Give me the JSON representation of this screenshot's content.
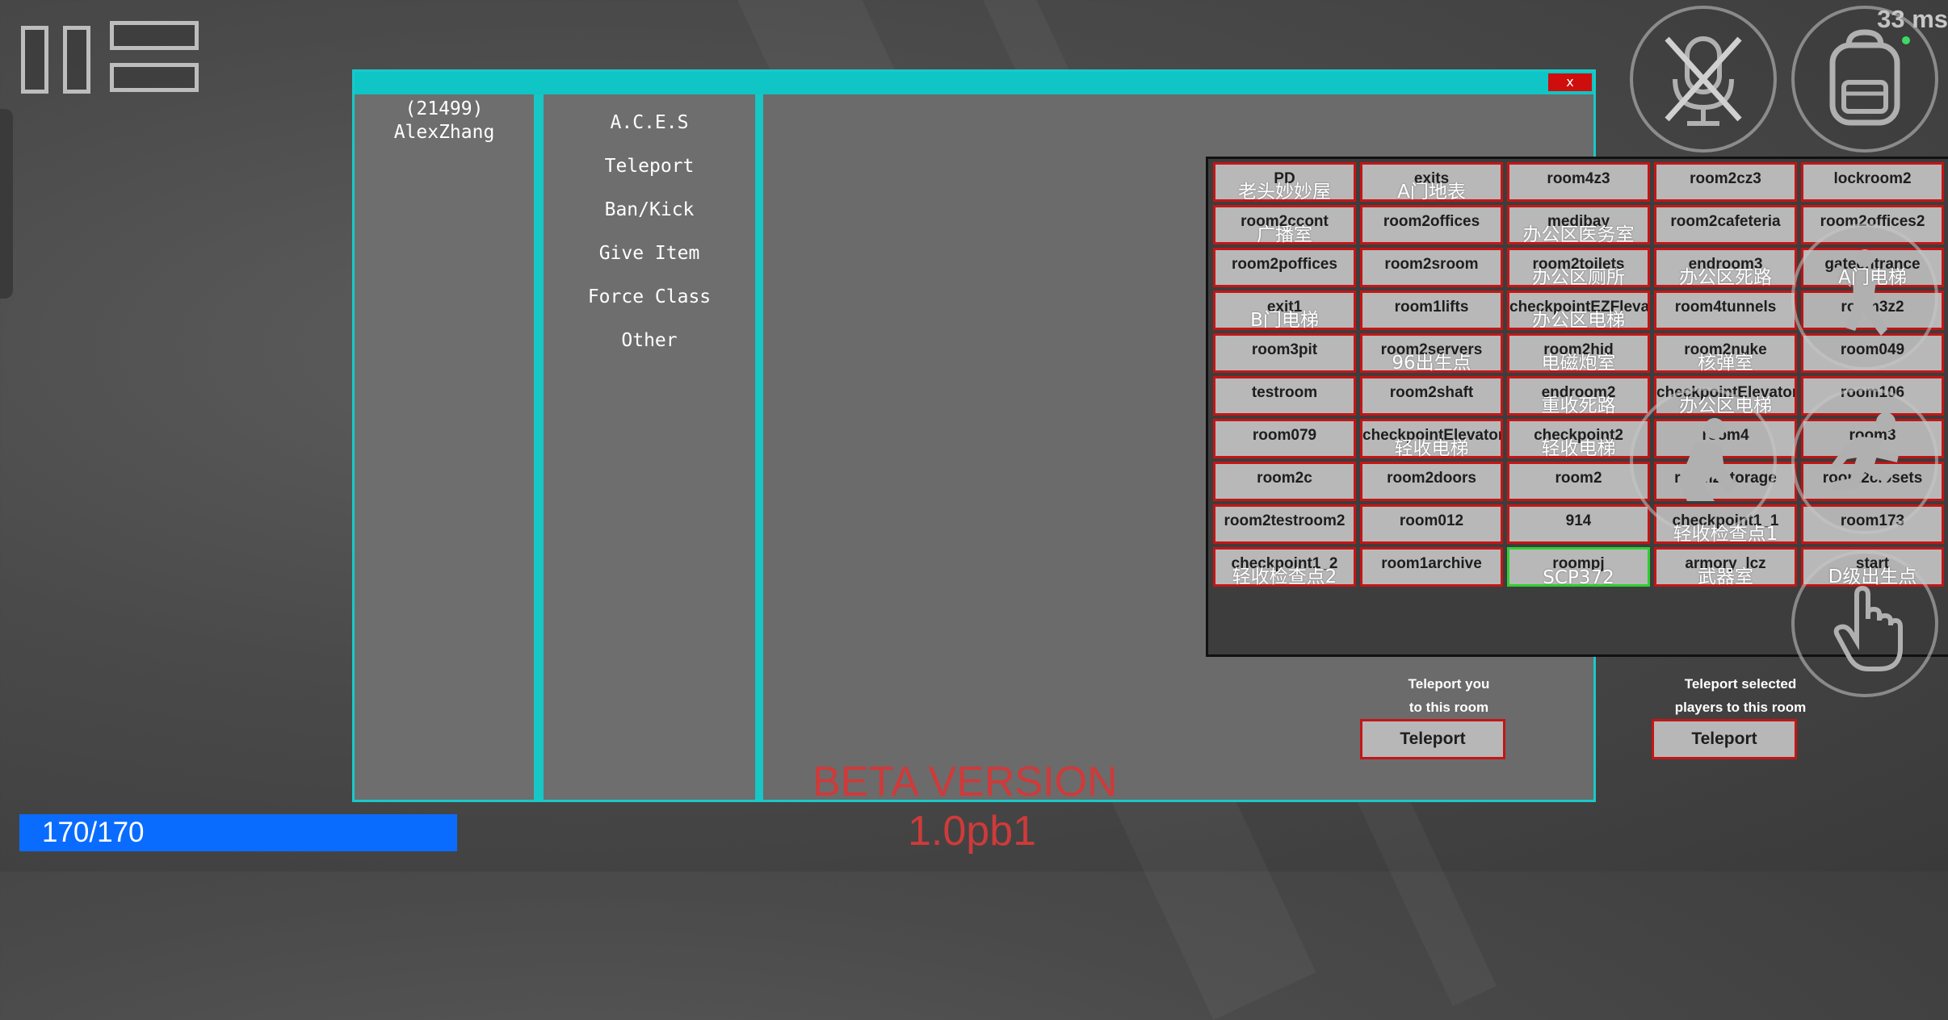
{
  "player": {
    "id": "(21499)",
    "name": "AlexZhang"
  },
  "menu": [
    "A.C.E.S",
    "Teleport",
    "Ban/Kick",
    "Give Item",
    "Force Class",
    "Other"
  ],
  "close_label": "x",
  "rooms": [
    {
      "name": "PD",
      "cn": "老头妙妙屋"
    },
    {
      "name": "exits",
      "cn": "A门地表"
    },
    {
      "name": "room4z3",
      "cn": ""
    },
    {
      "name": "room2cz3",
      "cn": ""
    },
    {
      "name": "lockroom2",
      "cn": ""
    },
    {
      "name": "room2ccont",
      "cn": "广播室"
    },
    {
      "name": "room2offices",
      "cn": ""
    },
    {
      "name": "medibay",
      "cn": "办公区医务室"
    },
    {
      "name": "room2cafeteria",
      "cn": ""
    },
    {
      "name": "room2offices2",
      "cn": ""
    },
    {
      "name": "room2poffices",
      "cn": ""
    },
    {
      "name": "room2sroom",
      "cn": ""
    },
    {
      "name": "room2toilets",
      "cn": "办公区厕所"
    },
    {
      "name": "endroom3",
      "cn": "办公区死路"
    },
    {
      "name": "gateentrance",
      "cn": "A门电梯"
    },
    {
      "name": "exit1",
      "cn": "B门电梯"
    },
    {
      "name": "room1lifts",
      "cn": ""
    },
    {
      "name": "checkpointEZFleva",
      "cn": "办公区电梯"
    },
    {
      "name": "room4tunnels",
      "cn": ""
    },
    {
      "name": "room3z2",
      "cn": ""
    },
    {
      "name": "room3pit",
      "cn": ""
    },
    {
      "name": "room2servers",
      "cn": "96出生点"
    },
    {
      "name": "room2hid",
      "cn": "电磁炮室"
    },
    {
      "name": "room2nuke",
      "cn": "核弹室"
    },
    {
      "name": "room049",
      "cn": ""
    },
    {
      "name": "testroom",
      "cn": ""
    },
    {
      "name": "room2shaft",
      "cn": ""
    },
    {
      "name": "endroom2",
      "cn": "重收死路"
    },
    {
      "name": "checkpointElevator",
      "cn": "办公区电梯"
    },
    {
      "name": "room106",
      "cn": ""
    },
    {
      "name": "room079",
      "cn": ""
    },
    {
      "name": "checkpointElevator",
      "cn": "轻收电梯"
    },
    {
      "name": "checkpoint2",
      "cn": "轻收电梯"
    },
    {
      "name": "room4",
      "cn": ""
    },
    {
      "name": "room3",
      "cn": ""
    },
    {
      "name": "room2c",
      "cn": ""
    },
    {
      "name": "room2doors",
      "cn": ""
    },
    {
      "name": "room2",
      "cn": ""
    },
    {
      "name": "room2storage",
      "cn": ""
    },
    {
      "name": "room2closets",
      "cn": ""
    },
    {
      "name": "room2testroom2",
      "cn": ""
    },
    {
      "name": "room012",
      "cn": ""
    },
    {
      "name": "914",
      "cn": ""
    },
    {
      "name": "checkpoint1_1",
      "cn": "轻收检查点1"
    },
    {
      "name": "room173",
      "cn": ""
    },
    {
      "name": "checkpoint1_2",
      "cn": "轻收检查点2"
    },
    {
      "name": "room1archive",
      "cn": ""
    },
    {
      "name": "roompj",
      "cn": "SCP372",
      "selected": true
    },
    {
      "name": "armory_lcz",
      "cn": "武器室"
    },
    {
      "name": "start",
      "cn": "D级出生点"
    }
  ],
  "teleport_self": {
    "caption_line1": "Teleport you",
    "caption_line2": "to this room",
    "button": "Teleport"
  },
  "teleport_selected": {
    "caption_line1": "Teleport selected",
    "caption_line2": "players to this room",
    "button": "Teleport"
  },
  "beta": {
    "line1": "BETA VERSION",
    "line2": "1.0pb1"
  },
  "health": {
    "text": "170/170",
    "current": 170,
    "max": 170
  },
  "ping": "33 ms",
  "colors": {
    "accent": "#0fc5c5",
    "cell_border": "#c51515",
    "selected_border": "#2ed02e",
    "health_bar": "#0a6cff",
    "beta_text": "#cf3a3a"
  },
  "icons": [
    "pause-icon",
    "mute-mic-icon",
    "backpack-icon",
    "jump-icon",
    "crouch-icon",
    "sprint-icon",
    "interact-hand-icon"
  ]
}
